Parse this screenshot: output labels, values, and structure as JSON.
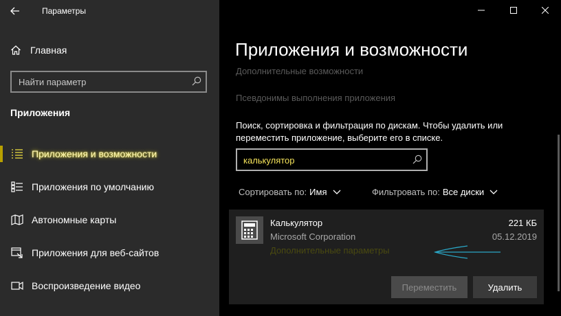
{
  "window": {
    "title": "Параметры"
  },
  "sidebar": {
    "home_label": "Главная",
    "search_placeholder": "Найти параметр",
    "section_title": "Приложения",
    "items": [
      {
        "label": "Приложения и возможности",
        "icon": "apps-features-icon",
        "active": true
      },
      {
        "label": "Приложения по умолчанию",
        "icon": "default-apps-icon",
        "active": false
      },
      {
        "label": "Автономные карты",
        "icon": "offline-maps-icon",
        "active": false
      },
      {
        "label": "Приложения для веб-сайтов",
        "icon": "apps-for-websites-icon",
        "active": false
      },
      {
        "label": "Воспроизведение видео",
        "icon": "video-playback-icon",
        "active": false
      }
    ]
  },
  "main": {
    "title": "Приложения и возможности",
    "links": [
      "Дополнительные возможности",
      "Псевдонимы выполнения приложения"
    ],
    "description_line1": "Поиск, сортировка и фильтрация по дискам. Чтобы удалить или",
    "description_line2": "переместить приложение, выберите его в списке.",
    "search_value": "калькулятор",
    "sort_label": "Сортировать по:",
    "sort_value": "Имя",
    "filter_label": "Фильтровать по:",
    "filter_value": "Все диски",
    "app": {
      "name": "Калькулятор",
      "publisher": "Microsoft Corporation",
      "advanced_link": "Дополнительные параметры",
      "size": "221 КБ",
      "date": "05.12.2019",
      "move_button": "Переместить",
      "uninstall_button": "Удалить"
    }
  },
  "colors": {
    "sidebar_bg": "#2b2b2b",
    "main_bg": "#000000",
    "accent_yellow": "#f5e35a",
    "annotation_arrow": "#2aa8c8"
  }
}
